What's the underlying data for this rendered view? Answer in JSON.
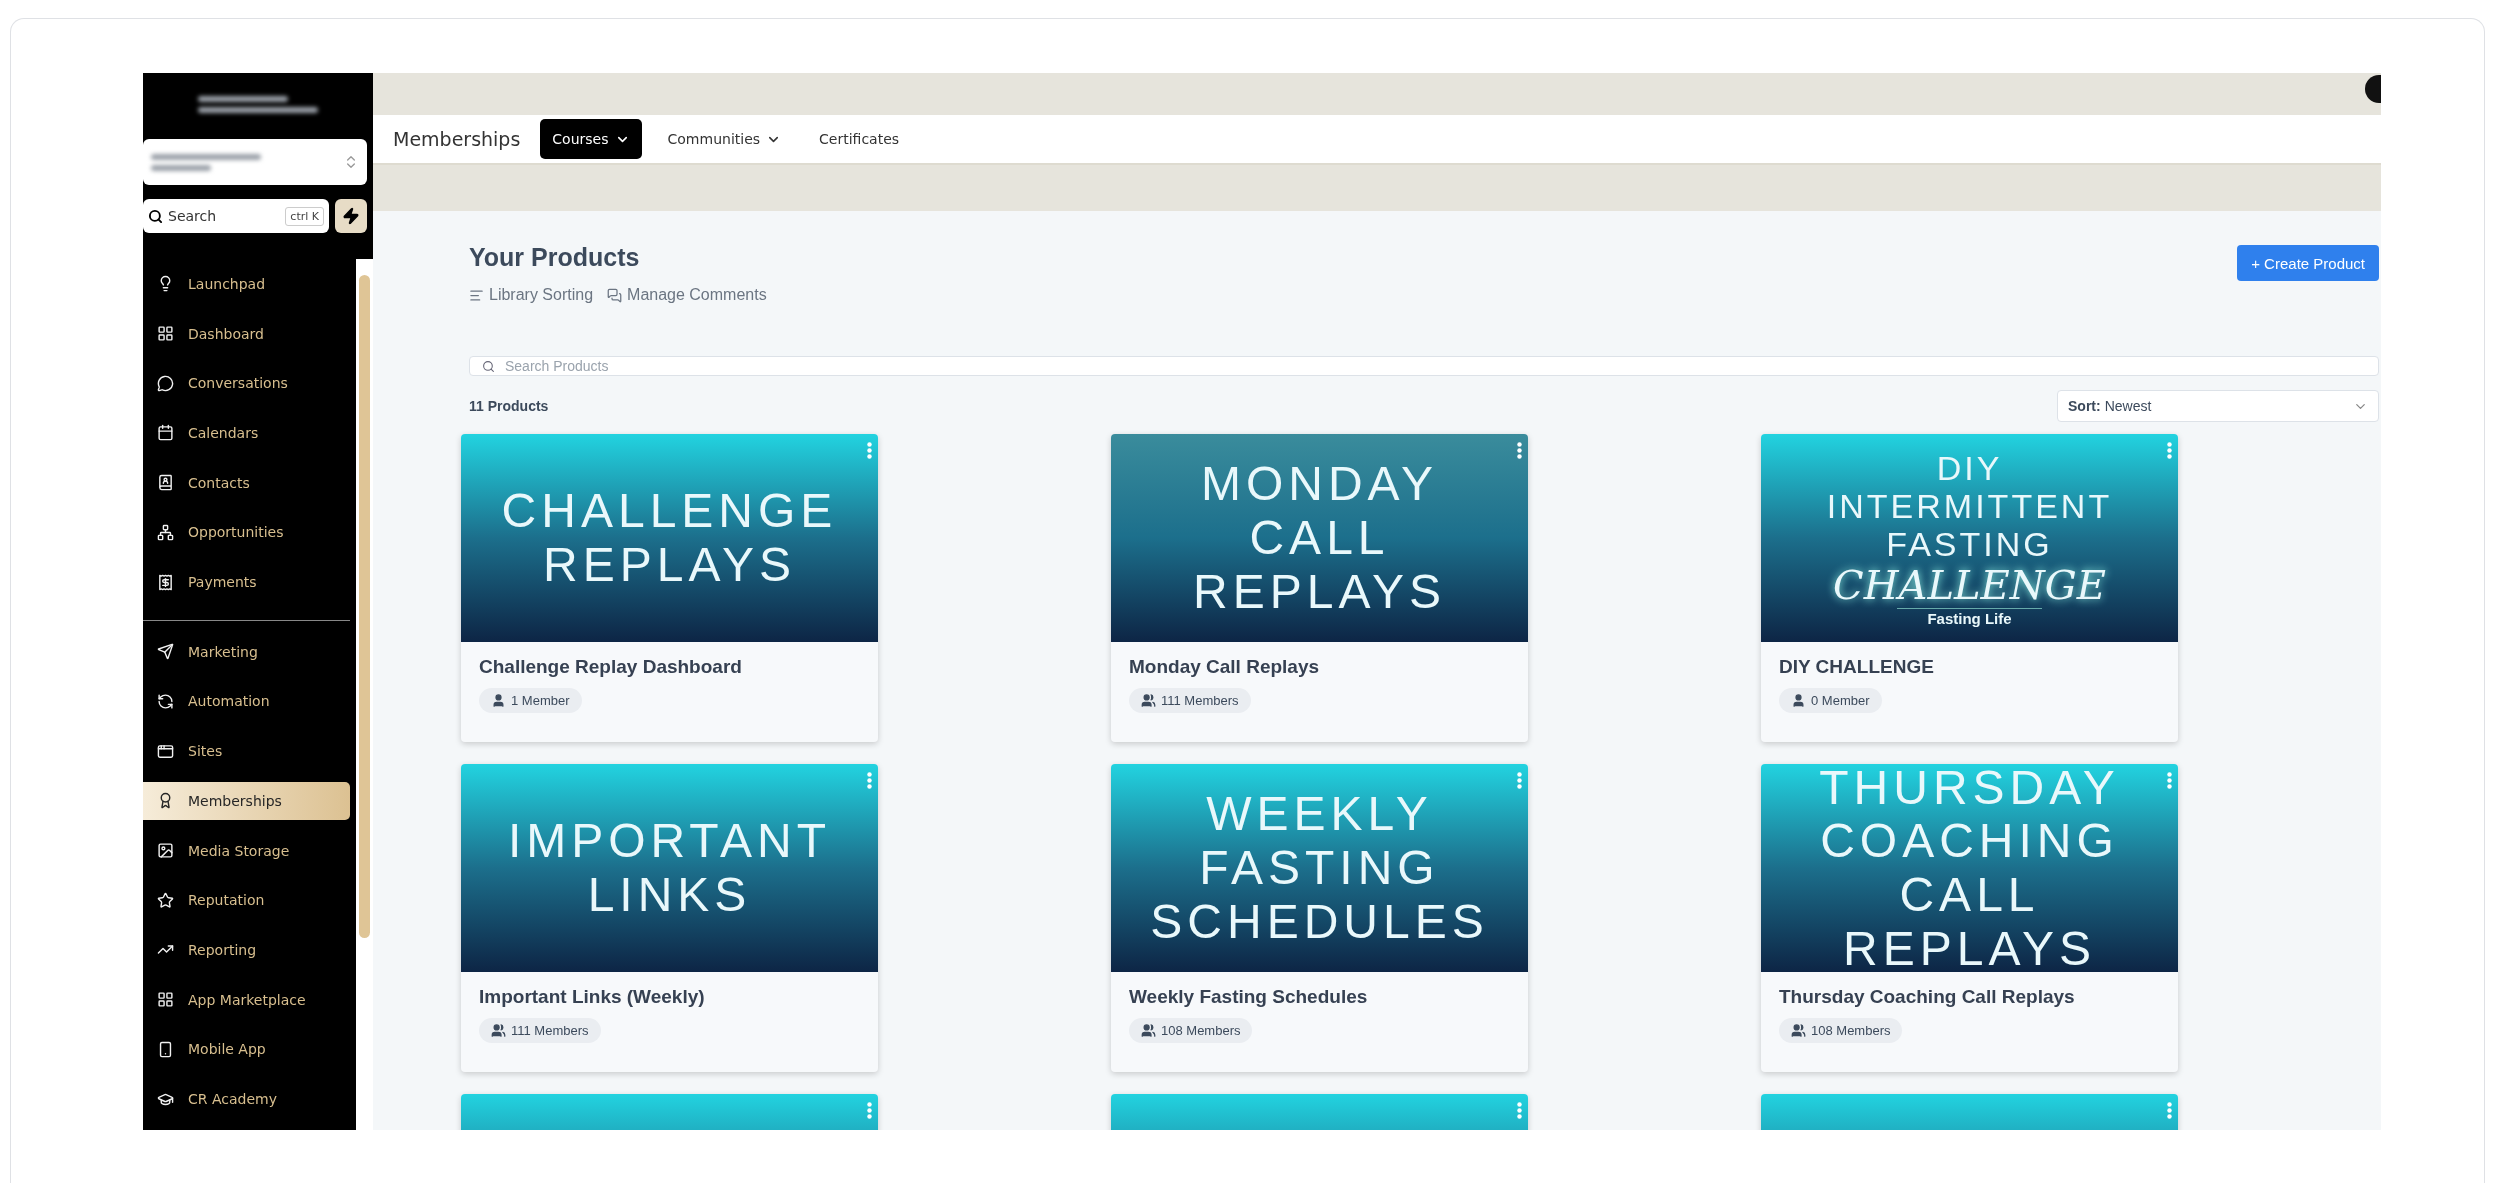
{
  "sidebar": {
    "search": {
      "placeholder": "Search",
      "shortcut": "ctrl K"
    },
    "sections": [
      {
        "items": [
          {
            "label": "Launchpad",
            "selected": false
          },
          {
            "label": "Dashboard",
            "selected": false
          },
          {
            "label": "Conversations",
            "selected": false
          },
          {
            "label": "Calendars",
            "selected": false
          },
          {
            "label": "Contacts",
            "selected": false
          },
          {
            "label": "Opportunities",
            "selected": false
          },
          {
            "label": "Payments",
            "selected": false
          }
        ]
      },
      {
        "items": [
          {
            "label": "Marketing",
            "selected": false
          },
          {
            "label": "Automation",
            "selected": false
          },
          {
            "label": "Sites",
            "selected": false
          },
          {
            "label": "Memberships",
            "selected": true
          },
          {
            "label": "Media Storage",
            "selected": false
          },
          {
            "label": "Reputation",
            "selected": false
          },
          {
            "label": "Reporting",
            "selected": false
          },
          {
            "label": "App Marketplace",
            "selected": false
          },
          {
            "label": "Mobile App",
            "selected": false
          },
          {
            "label": "CR Academy",
            "selected": false
          }
        ]
      }
    ]
  },
  "topnav": {
    "title": "Memberships",
    "tabs": [
      {
        "label": "Courses",
        "selected": true,
        "dropdown": true
      },
      {
        "label": "Communities",
        "selected": false,
        "dropdown": true
      },
      {
        "label": "Certificates",
        "selected": false,
        "dropdown": false
      }
    ]
  },
  "products": {
    "title": "Your Products",
    "links": [
      "Library Sorting",
      "Manage Comments"
    ],
    "create_button": "+ Create Product",
    "search": {
      "placeholder": "Search Products"
    },
    "count": "11 Products",
    "sort": {
      "label": "Sort:",
      "value": "Newest"
    },
    "cards": [
      {
        "title": "Challenge Replay Dashboard",
        "members": "1 Member",
        "kind": "single",
        "color": "#22d3e0",
        "lines": [
          {
            "text": "CHALLENGE",
            "kind": "plain"
          },
          {
            "text": "REPLAYS",
            "kind": "plain"
          }
        ]
      },
      {
        "title": "Monday Call Replays",
        "members": "111 Members",
        "kind": "group",
        "color": "#3a8c9c",
        "lines": [
          {
            "text": "MONDAY",
            "kind": "plain"
          },
          {
            "text": "CALL",
            "kind": "plain"
          },
          {
            "text": "REPLAYS",
            "kind": "plain"
          }
        ]
      },
      {
        "title": "DIY CHALLENGE",
        "members": "0 Member",
        "kind": "single",
        "color": "#22d3e0",
        "lines": [
          {
            "text": "DIY",
            "kind": "small"
          },
          {
            "text": "INTERMITTENT",
            "kind": "small"
          },
          {
            "text": "FASTING",
            "kind": "small"
          },
          {
            "text": "CHALLENGE",
            "kind": "script"
          },
          {
            "text": "Fasting Life",
            "kind": "logo"
          }
        ]
      },
      {
        "title": "Important Links (Weekly)",
        "members": "111 Members",
        "kind": "group",
        "color": "#22d3e0",
        "lines": [
          {
            "text": "IMPORTANT",
            "kind": "plain"
          },
          {
            "text": "LINKS",
            "kind": "plain"
          }
        ]
      },
      {
        "title": "Weekly Fasting Schedules",
        "members": "108 Members",
        "kind": "group",
        "color": "#22d3e0",
        "lines": [
          {
            "text": "WEEKLY",
            "kind": "plain"
          },
          {
            "text": "FASTING",
            "kind": "plain"
          },
          {
            "text": "SCHEDULES",
            "kind": "plain"
          }
        ]
      },
      {
        "title": "Thursday Coaching Call Replays",
        "members": "108 Members",
        "kind": "group",
        "color": "#22d3e0",
        "lines": [
          {
            "text": "THURSDAY",
            "kind": "plain"
          },
          {
            "text": "COACHING",
            "kind": "plain"
          },
          {
            "text": "CALL",
            "kind": "plain"
          },
          {
            "text": "REPLAYS",
            "kind": "plain"
          }
        ]
      }
    ],
    "more_cards": [
      {
        "color": "#22d3e0"
      },
      {
        "color": "#22d3e0"
      },
      {
        "color": "#22d3e0"
      }
    ]
  }
}
